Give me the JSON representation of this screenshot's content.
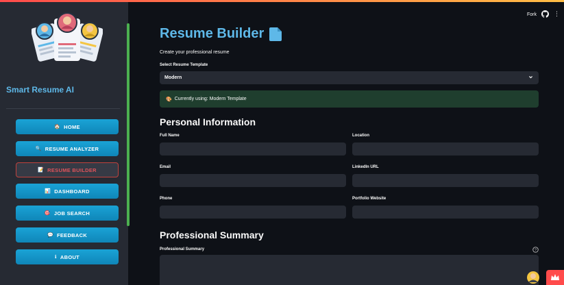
{
  "sidebar": {
    "brand": "Smart Resume AI",
    "nav": [
      {
        "label": "HOME",
        "icon": "home-icon",
        "glyph": "🏠",
        "active": false
      },
      {
        "label": "RESUME ANALYZER",
        "icon": "search-icon",
        "glyph": "🔍",
        "active": false
      },
      {
        "label": "RESUME BUILDER",
        "icon": "document-icon",
        "glyph": "📝",
        "active": true
      },
      {
        "label": "DASHBOARD",
        "icon": "chart-icon",
        "glyph": "📊",
        "active": false
      },
      {
        "label": "JOB SEARCH",
        "icon": "target-icon",
        "glyph": "🎯",
        "active": false
      },
      {
        "label": "FEEDBACK",
        "icon": "chat-icon",
        "glyph": "💬",
        "active": false
      },
      {
        "label": "ABOUT",
        "icon": "info-icon",
        "glyph": "ℹ",
        "active": false
      }
    ]
  },
  "header": {
    "fork_label": "Fork"
  },
  "main": {
    "title": "Resume Builder",
    "subtitle": "Create your professional resume",
    "template_label": "Select Resume Template",
    "template_value": "Modern",
    "alert_icon_glyph": "🎨",
    "alert_text": "Currently using: Modern Template",
    "personal_heading": "Personal Information",
    "fields": {
      "full_name": "Full Name",
      "location": "Location",
      "email": "Email",
      "linkedin": "LinkedIn URL",
      "phone": "Phone",
      "portfolio": "Portfolio Website"
    },
    "summary_heading": "Professional Summary",
    "summary_label": "Professional Summary"
  },
  "colors": {
    "accent": "#5eb8e8",
    "nav_button": "#1aa3d6",
    "active_border": "#c1423d",
    "alert_bg": "#1f3e2e",
    "sidebar_scroll": "#4caf50"
  }
}
